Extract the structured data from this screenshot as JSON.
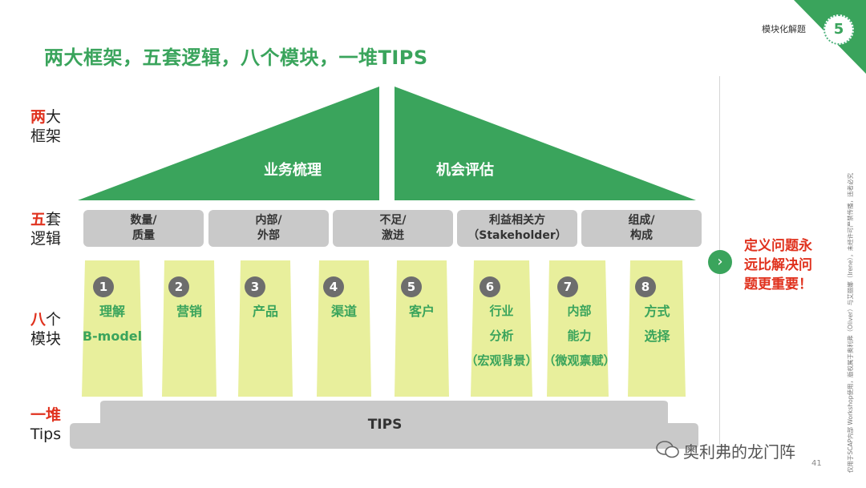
{
  "header": {
    "title": "两大框架，五套逻辑，八个模块，一堆TIPS",
    "section_tag": "模块化解题",
    "page_badge": "5",
    "accent_color": "#3aa45c"
  },
  "row_labels": [
    {
      "highlight": "两",
      "rest": "大",
      "line2": "框架"
    },
    {
      "highlight": "五",
      "rest": "套",
      "line2": "逻辑"
    },
    {
      "highlight": "八",
      "rest": "个",
      "line2": "模块"
    },
    {
      "highlight": "一堆",
      "rest": "",
      "line2": "Tips"
    }
  ],
  "frameworks": [
    "业务梳理",
    "机会评估"
  ],
  "logics": [
    {
      "line1": "数量/",
      "line2": "质量"
    },
    {
      "line1": "内部/",
      "line2": "外部"
    },
    {
      "line1": "不足/",
      "line2": "激进"
    },
    {
      "line1": "利益相关方",
      "line2": "（Stakeholder）"
    },
    {
      "line1": "组成/",
      "line2": "构成"
    }
  ],
  "modules": [
    {
      "num": "1",
      "lines": [
        "理解",
        "B-model"
      ]
    },
    {
      "num": "2",
      "lines": [
        "营销"
      ]
    },
    {
      "num": "3",
      "lines": [
        "产品"
      ]
    },
    {
      "num": "4",
      "lines": [
        "渠道"
      ]
    },
    {
      "num": "5",
      "lines": [
        "客户"
      ]
    },
    {
      "num": "6",
      "lines": [
        "行业",
        "分析",
        "（宏观背景）"
      ]
    },
    {
      "num": "7",
      "lines": [
        "内部",
        "能力",
        "（微观禀赋）"
      ]
    },
    {
      "num": "8",
      "lines": [
        "方式",
        "选择"
      ]
    }
  ],
  "base_label": "TIPS",
  "conclusion": [
    "定义问题永",
    "远比解决问",
    "题更重要！"
  ],
  "side_note": "仅用于SCAP内部 Workshop使用，版权属于奥利弗（Oliver）与艾丽娜（Irene），未经许可严禁传播，违者必究",
  "watermark": "奥利弗的龙门阵",
  "slide_number": "41"
}
